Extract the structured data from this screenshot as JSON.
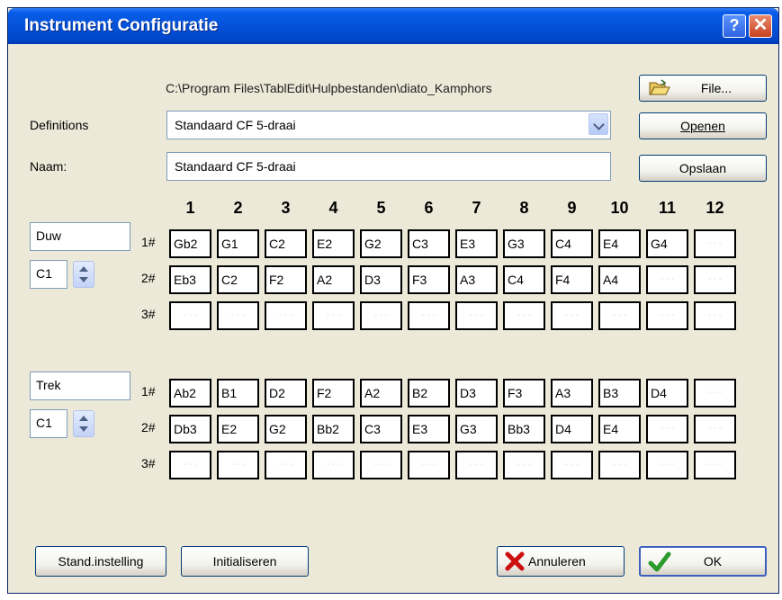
{
  "window": {
    "title": "Instrument Configuratie",
    "help_label": "?",
    "close_label": "✕"
  },
  "file": {
    "path": "C:\\Program Files\\TablEdit\\Hulpbestanden\\diato_Kamphors",
    "button_label": "File..."
  },
  "definitions": {
    "label": "Definitions",
    "value": "Standaard CF 5-draai",
    "open_label": "Openen"
  },
  "naam": {
    "label": "Naam:",
    "value": "Standaard CF 5-draai",
    "save_label": "Opslaan"
  },
  "columns": [
    "1",
    "2",
    "3",
    "4",
    "5",
    "6",
    "7",
    "8",
    "9",
    "10",
    "11",
    "12"
  ],
  "row_labels": [
    "1#",
    "2#",
    "3#"
  ],
  "empty_cell": "- - -",
  "duw": {
    "name": "Duw",
    "key": "C1",
    "rows": [
      [
        "Gb2",
        "G1",
        "C2",
        "E2",
        "G2",
        "C3",
        "E3",
        "G3",
        "C4",
        "E4",
        "G4",
        ""
      ],
      [
        "Eb3",
        "C2",
        "F2",
        "A2",
        "D3",
        "F3",
        "A3",
        "C4",
        "F4",
        "A4",
        "",
        ""
      ],
      [
        "",
        "",
        "",
        "",
        "",
        "",
        "",
        "",
        "",
        "",
        "",
        ""
      ]
    ]
  },
  "trek": {
    "name": "Trek",
    "key": "C1",
    "rows": [
      [
        "Ab2",
        "B1",
        "D2",
        "F2",
        "A2",
        "B2",
        "D3",
        "F3",
        "A3",
        "B3",
        "D4",
        ""
      ],
      [
        "Db3",
        "E2",
        "G2",
        "Bb2",
        "C3",
        "E3",
        "G3",
        "Bb3",
        "D4",
        "E4",
        "",
        ""
      ],
      [
        "",
        "",
        "",
        "",
        "",
        "",
        "",
        "",
        "",
        "",
        "",
        ""
      ]
    ]
  },
  "buttons": {
    "standard": "Stand.instelling",
    "initialize": "Initialiseren",
    "cancel": "Annuleren",
    "ok": "OK"
  },
  "colors": {
    "titlebar": "#0452d8",
    "dialog_bg": "#ece9d8",
    "cancel_icon": "#cc1010",
    "ok_icon": "#2a9a2a"
  }
}
